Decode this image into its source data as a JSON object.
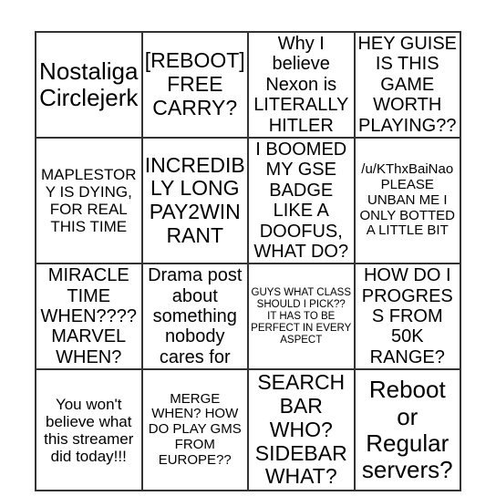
{
  "card": {
    "type": "bingo-card",
    "rows": 4,
    "columns": 4,
    "border_color": "#333333",
    "background_color": "#ffffff",
    "text_color": "#000000",
    "cells": [
      [
        {
          "text": "Nostaliga Circlejerk",
          "size": "xl"
        },
        {
          "text": "[REBOOT] FREE CARRY?",
          "size": "lg"
        },
        {
          "text": "Why I believe Nexon is LITERALLY HITLER",
          "size": "md"
        },
        {
          "text": "HEY GUISE IS THIS GAME WORTH PLAYING??",
          "size": "md"
        }
      ],
      [
        {
          "text": "MAPLESTORY IS DYING, FOR REAL THIS TIME",
          "size": "sm"
        },
        {
          "text": "INCREDIBLY LONG PAY2WIN RANT",
          "size": "lg"
        },
        {
          "text": "I BOOMED MY GSE BADGE LIKE A DOOFUS, WHAT DO?",
          "size": "md"
        },
        {
          "text": "/u/KThxBaiNao PLEASE UNBAN ME I ONLY BOTTED A LITTLE BIT",
          "size": "xs"
        }
      ],
      [
        {
          "text": "MIRACLE TIME WHEN???? MARVEL WHEN?",
          "size": "md"
        },
        {
          "text": "Drama post about something nobody cares for",
          "size": "md"
        },
        {
          "text": "GUYS WHAT CLASS SHOULD I PICK?? IT HAS TO BE PERFECT IN EVERY ASPECT",
          "size": "xxs"
        },
        {
          "text": "HOW DO I PROGRESS FROM 50K RANGE?",
          "size": "md"
        }
      ],
      [
        {
          "text": "You won't believe what this streamer did today!!!",
          "size": "sm"
        },
        {
          "text": "MERGE WHEN? HOW DO PLAY GMS FROM EUROPE??",
          "size": "xs"
        },
        {
          "text": "SEARCH BAR WHO? SIDEBAR WHAT?",
          "size": "lg"
        },
        {
          "text": "Reboot or Regular servers?",
          "size": "xl"
        }
      ]
    ]
  }
}
